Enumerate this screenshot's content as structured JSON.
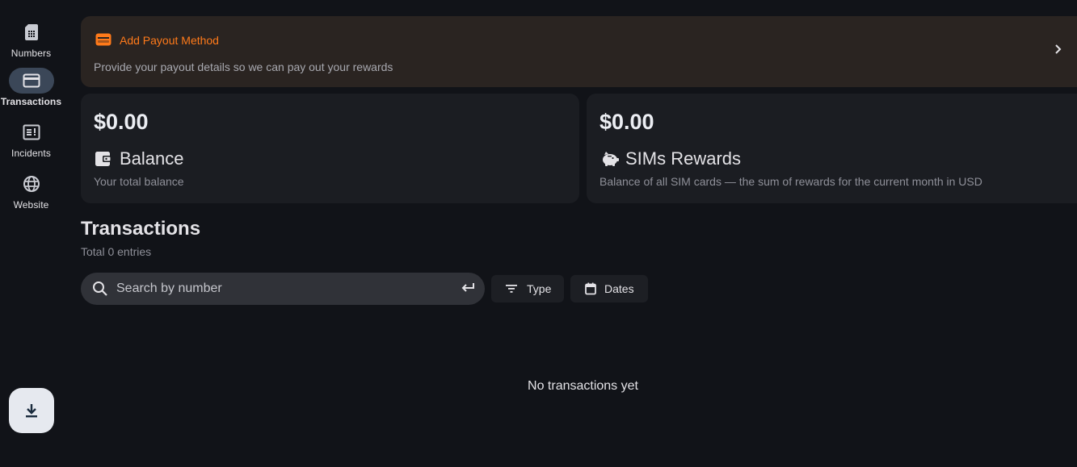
{
  "nav": {
    "items": [
      {
        "label": "Numbers",
        "icon": "sim-card-icon"
      },
      {
        "label": "Transactions",
        "icon": "credit-card-icon",
        "active": true
      },
      {
        "label": "Incidents",
        "icon": "report-icon"
      },
      {
        "label": "Website",
        "icon": "globe-icon"
      }
    ],
    "fab_icon": "download-icon"
  },
  "payout": {
    "title": "Add Payout Method",
    "description": "Provide your payout details so we can pay out your rewards",
    "accent": "#ff7a1a"
  },
  "cards": {
    "balance": {
      "amount": "$0.00",
      "title": "Balance",
      "description": "Your total balance",
      "icon": "wallet-icon"
    },
    "rewards": {
      "amount": "$0.00",
      "title": "SIMs Rewards",
      "description": "Balance of all SIM cards — the sum of rewards for the current month in USD",
      "icon": "piggy-bank-icon"
    }
  },
  "transactions": {
    "title": "Transactions",
    "subtitle": "Total 0 entries",
    "search_placeholder": "Search by number",
    "filters": {
      "type_label": "Type",
      "dates_label": "Dates"
    },
    "empty_text": "No transactions yet"
  }
}
